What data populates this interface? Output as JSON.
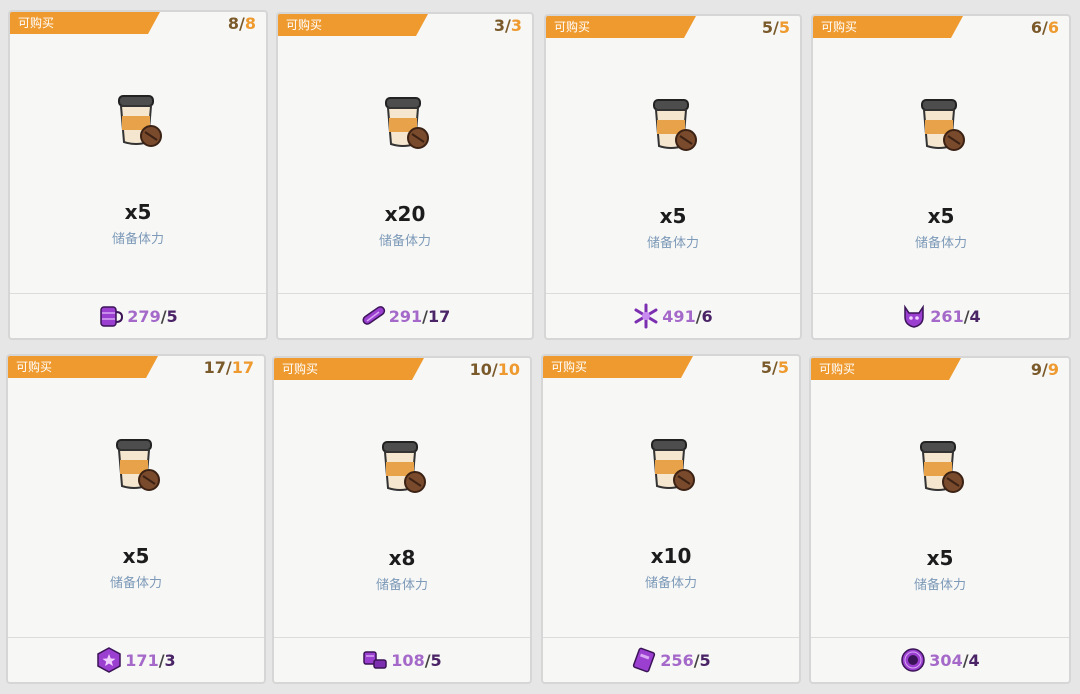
{
  "cards": [
    {
      "tag": "可购买",
      "limit_current": "8",
      "limit_max": "8",
      "amount": "x5",
      "name": "储备体力",
      "have": "279",
      "cost": "5",
      "currency_icon": "purple-mug-icon"
    },
    {
      "tag": "可购买",
      "limit_current": "3",
      "limit_max": "3",
      "amount": "x20",
      "name": "储备体力",
      "have": "291",
      "cost": "17",
      "currency_icon": "purple-tube-icon"
    },
    {
      "tag": "可购买",
      "limit_current": "5",
      "limit_max": "5",
      "amount": "x5",
      "name": "储备体力",
      "have": "491",
      "cost": "6",
      "currency_icon": "purple-snowflake-icon"
    },
    {
      "tag": "可购买",
      "limit_current": "6",
      "limit_max": "6",
      "amount": "x5",
      "name": "储备体力",
      "have": "261",
      "cost": "4",
      "currency_icon": "purple-demon-icon"
    },
    {
      "tag": "可购买",
      "limit_current": "17",
      "limit_max": "17",
      "amount": "x5",
      "name": "储备体力",
      "have": "171",
      "cost": "3",
      "currency_icon": "purple-star-badge-icon"
    },
    {
      "tag": "可购买",
      "limit_current": "10",
      "limit_max": "10",
      "amount": "x8",
      "name": "储备体力",
      "have": "108",
      "cost": "5",
      "currency_icon": "purple-bolt-icon"
    },
    {
      "tag": "可购买",
      "limit_current": "5",
      "limit_max": "5",
      "amount": "x10",
      "name": "储备体力",
      "have": "256",
      "cost": "5",
      "currency_icon": "purple-book-icon"
    },
    {
      "tag": "可购买",
      "limit_current": "9",
      "limit_max": "9",
      "amount": "x5",
      "name": "储备体力",
      "have": "304",
      "cost": "4",
      "currency_icon": "purple-ring-icon"
    }
  ]
}
